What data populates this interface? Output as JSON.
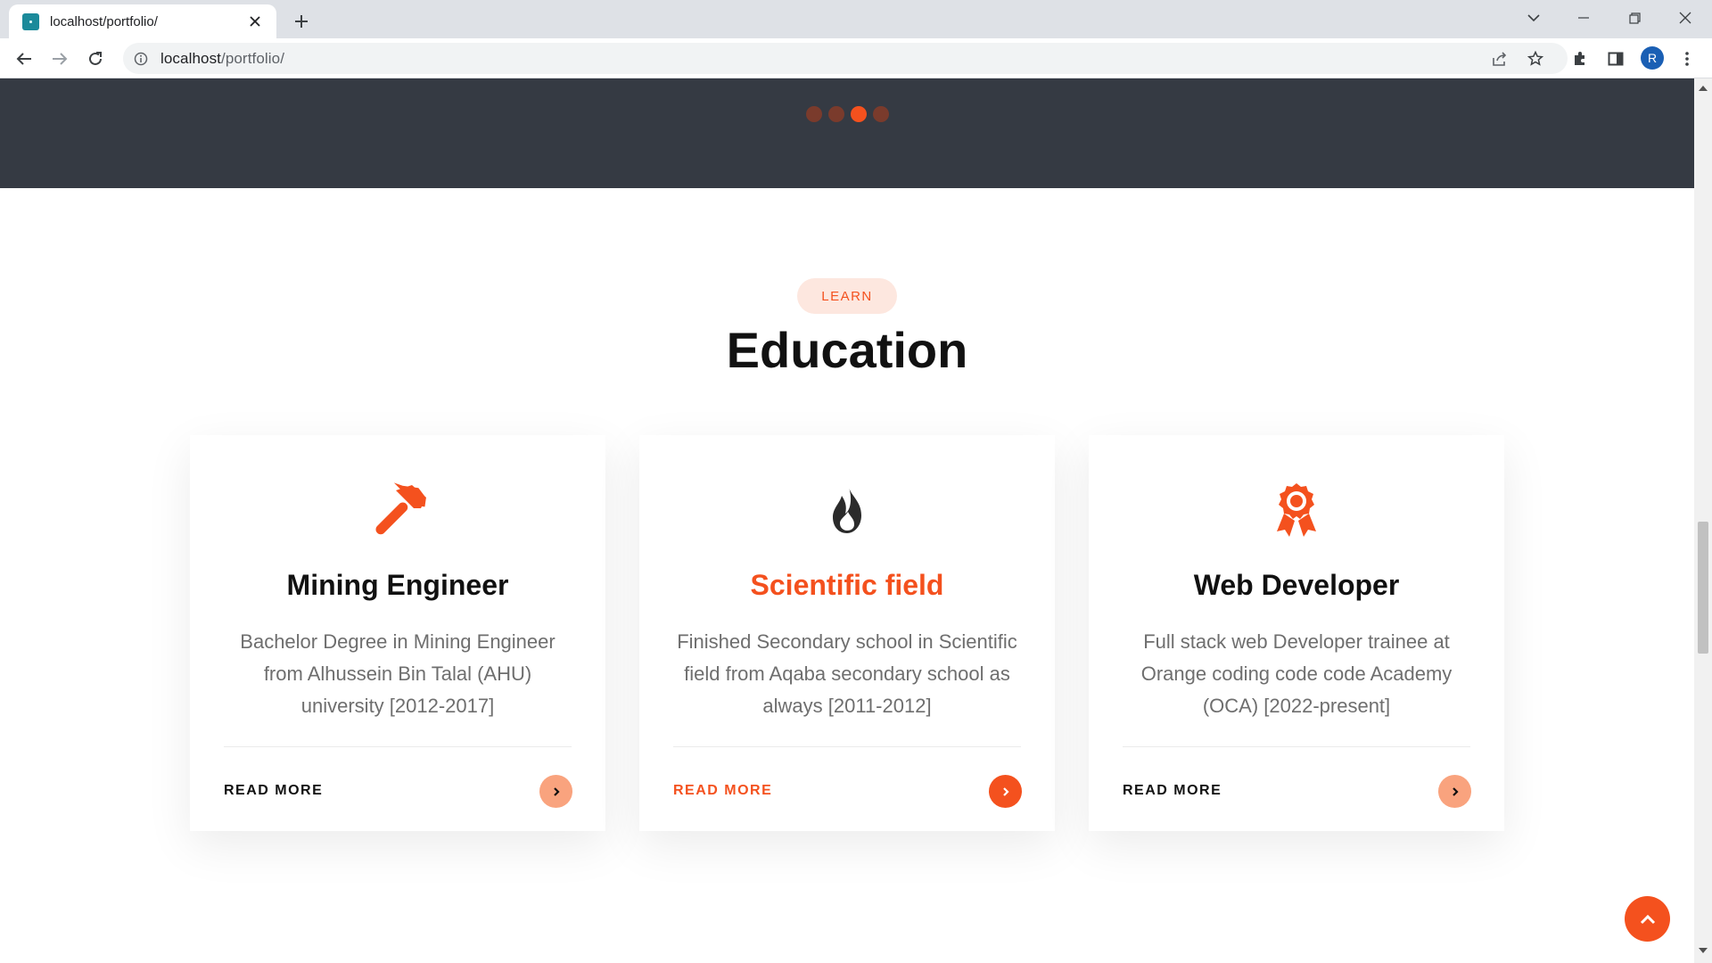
{
  "browser": {
    "tab_title": "localhost/portfolio/",
    "url_host": "localhost",
    "url_path": "/portfolio/",
    "profile_initial": "R"
  },
  "carousel": {
    "dot_count": 4,
    "active_index": 2
  },
  "section": {
    "eyebrow": "LEARN",
    "title": "Education"
  },
  "cards": [
    {
      "icon": "hammer-icon",
      "title": "Mining Engineer",
      "text": "Bachelor Degree in Mining Engineer from Alhussein Bin Talal (AHU) university [2012-2017]",
      "link_label": "READ MORE",
      "featured": false
    },
    {
      "icon": "flame-icon",
      "title": "Scientific field",
      "text": "Finished Secondary school in Scientific field from Aqaba secondary school as always [2011-2012]",
      "link_label": "READ MORE",
      "featured": true
    },
    {
      "icon": "award-ribbon-icon",
      "title": "Web Developer",
      "text": "Full stack web Developer trainee at Orange coding code code Academy (OCA) [2022-present]",
      "link_label": "READ MORE",
      "featured": false
    }
  ],
  "colors": {
    "accent": "#f4511e",
    "accent_light": "#f9a37e",
    "pill_bg": "#fde7df",
    "dark_band": "#353a43",
    "heading": "#111111",
    "body_text": "#6e6e6e"
  }
}
